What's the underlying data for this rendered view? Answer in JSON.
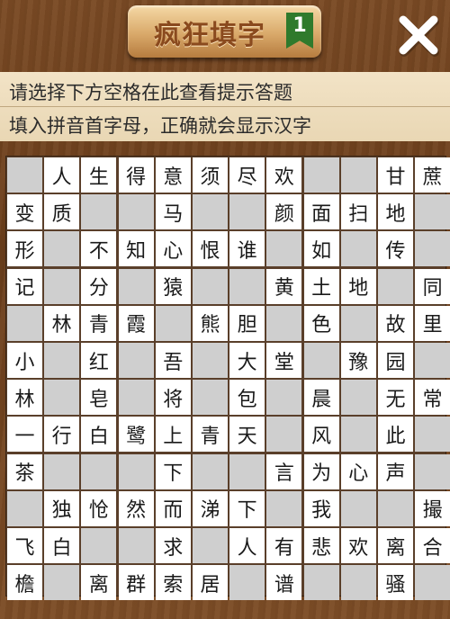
{
  "app": {
    "title": "疯狂填字",
    "level": "1"
  },
  "hints": {
    "line1": "请选择下方空格在此查看提示答题",
    "line2": "填入拼音首字母，正确就会显示汉字"
  },
  "icons": {
    "close": "close-icon",
    "level_ribbon": "bookmark-ribbon-icon"
  },
  "colors": {
    "blank_cell": "#cfcfcf",
    "filled_cell": "#ffffff",
    "grid_line": "#5a3f2a",
    "ribbon": "#2f7a2c"
  },
  "grid": [
    [
      "",
      "人",
      "生",
      "得",
      "意",
      "须",
      "尽",
      "欢",
      "",
      "",
      "甘",
      "蔗"
    ],
    [
      "变",
      "质",
      "",
      "",
      "马",
      "",
      "",
      "颜",
      "面",
      "扫",
      "地",
      ""
    ],
    [
      "形",
      "",
      "不",
      "知",
      "心",
      "恨",
      "谁",
      "",
      "如",
      "",
      "传",
      ""
    ],
    [
      "记",
      "",
      "分",
      "",
      "猿",
      "",
      "",
      "黄",
      "土",
      "地",
      "",
      "同"
    ],
    [
      "",
      "林",
      "青",
      "霞",
      "",
      "熊",
      "胆",
      "",
      "色",
      "",
      "故",
      "里"
    ],
    [
      "小",
      "",
      "红",
      "",
      "吾",
      "",
      "大",
      "堂",
      "",
      "豫",
      "园",
      ""
    ],
    [
      "林",
      "",
      "皂",
      "",
      "将",
      "",
      "包",
      "",
      "晨",
      "",
      "无",
      "常"
    ],
    [
      "一",
      "行",
      "白",
      "鹭",
      "上",
      "青",
      "天",
      "",
      "风",
      "",
      "此",
      ""
    ],
    [
      "茶",
      "",
      "",
      "",
      "下",
      "",
      "",
      "言",
      "为",
      "心",
      "声",
      ""
    ],
    [
      "",
      "独",
      "怆",
      "然",
      "而",
      "涕",
      "下",
      "",
      "我",
      "",
      "",
      "撮"
    ],
    [
      "飞",
      "白",
      "",
      "",
      "求",
      "",
      "人",
      "有",
      "悲",
      "欢",
      "离",
      "合"
    ],
    [
      "檐",
      "",
      "离",
      "群",
      "索",
      "居",
      "",
      "谱",
      "",
      "",
      "骚",
      ""
    ]
  ]
}
